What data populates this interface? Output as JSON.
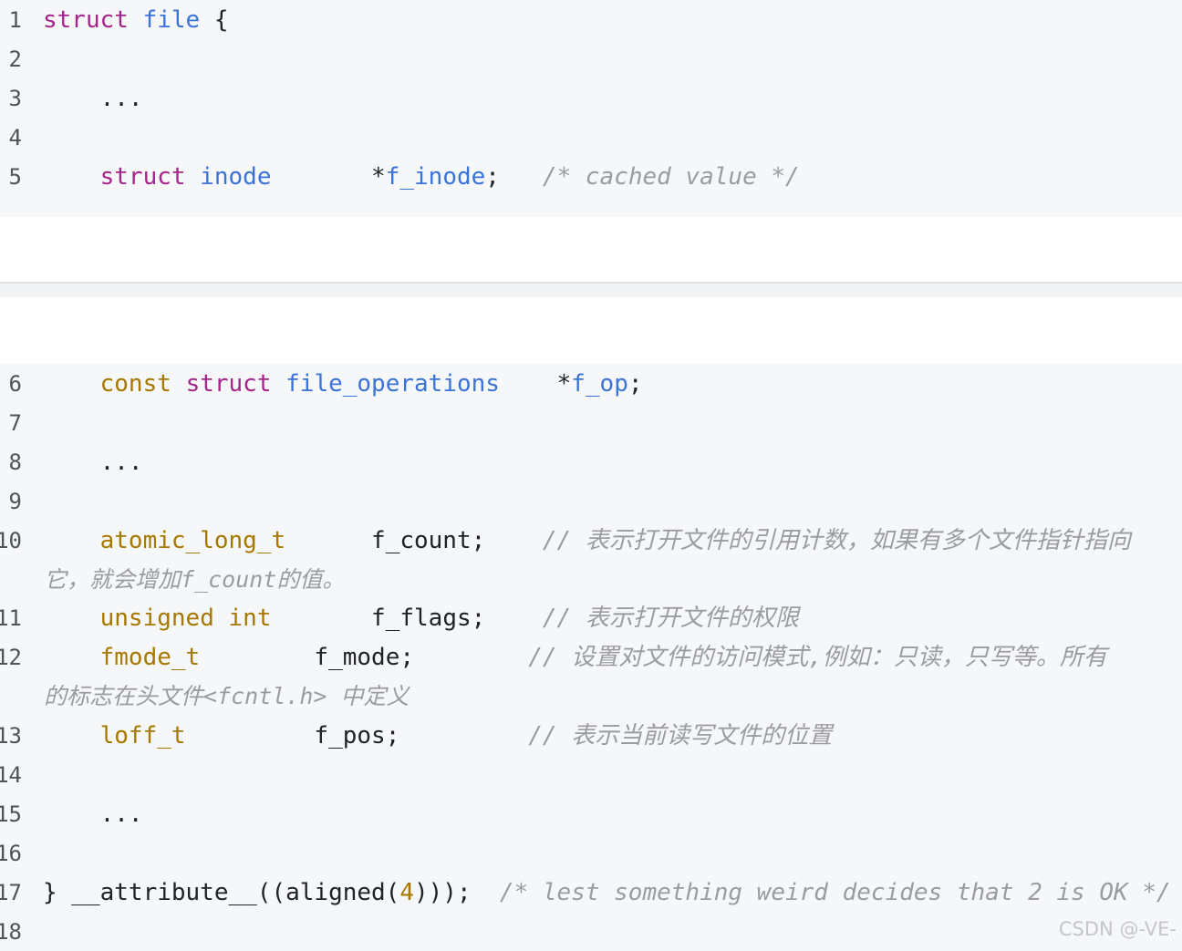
{
  "top_block": {
    "lines": [
      {
        "num": "1",
        "parts": [
          [
            "kw",
            "struct"
          ],
          [
            "",
            " "
          ],
          [
            "ty",
            "file"
          ],
          [
            "",
            " {"
          ]
        ]
      },
      {
        "num": "2",
        "parts": []
      },
      {
        "num": "3",
        "parts": [
          [
            "",
            "    ..."
          ]
        ]
      },
      {
        "num": "4",
        "parts": []
      },
      {
        "num": "5",
        "parts": [
          [
            "",
            "    "
          ],
          [
            "kw",
            "struct"
          ],
          [
            "",
            " "
          ],
          [
            "ty",
            "inode"
          ],
          [
            "",
            "       *"
          ],
          [
            "ty",
            "f_inode"
          ],
          [
            "",
            ";   "
          ],
          [
            "cm",
            "/* cached value */"
          ]
        ]
      }
    ]
  },
  "bottom_block": {
    "lines": [
      {
        "num": "6",
        "parts": [
          [
            "",
            "    "
          ],
          [
            "ty2",
            "const"
          ],
          [
            "",
            " "
          ],
          [
            "kw",
            "struct"
          ],
          [
            "",
            " "
          ],
          [
            "ty",
            "file_operations"
          ],
          [
            "",
            "    *"
          ],
          [
            "ty",
            "f_op"
          ],
          [
            "",
            ";"
          ]
        ]
      },
      {
        "num": "7",
        "parts": []
      },
      {
        "num": "8",
        "parts": [
          [
            "",
            "    ..."
          ]
        ]
      },
      {
        "num": "9",
        "parts": []
      },
      {
        "num": "10",
        "parts": [
          [
            "",
            "    "
          ],
          [
            "ty2",
            "atomic_long_t"
          ],
          [
            "",
            "      f_count;    "
          ],
          [
            "cm",
            "// 表示打开文件的引用计数，如果有多个文件指针指向"
          ]
        ],
        "cont": "它，就会增加f_count的值。"
      },
      {
        "num": "11",
        "parts": [
          [
            "",
            "    "
          ],
          [
            "ty2",
            "unsigned"
          ],
          [
            "",
            " "
          ],
          [
            "ty2",
            "int"
          ],
          [
            "",
            "       f_flags;    "
          ],
          [
            "cm",
            "// 表示打开文件的权限"
          ]
        ]
      },
      {
        "num": "12",
        "parts": [
          [
            "",
            "    "
          ],
          [
            "ty2",
            "fmode_t"
          ],
          [
            "",
            "        f_mode;        "
          ],
          [
            "cm",
            "// 设置对文件的访问模式,例如：只读，只写等。所有"
          ]
        ],
        "cont": "的标志在头文件<fcntl.h> 中定义"
      },
      {
        "num": "13",
        "parts": [
          [
            "",
            "    "
          ],
          [
            "ty2",
            "loff_t"
          ],
          [
            "",
            "         f_pos;         "
          ],
          [
            "cm",
            "// 表示当前读写文件的位置"
          ]
        ]
      },
      {
        "num": "14",
        "parts": []
      },
      {
        "num": "15",
        "parts": [
          [
            "",
            "    ..."
          ]
        ]
      },
      {
        "num": "16",
        "parts": []
      },
      {
        "num": "17",
        "parts": [
          [
            "",
            "} __attribute__((aligned("
          ],
          [
            "num",
            "4"
          ],
          [
            "",
            ")));  "
          ],
          [
            "cm",
            "/* lest something weird decides that 2 is OK */"
          ]
        ]
      },
      {
        "num": "18",
        "parts": []
      }
    ]
  },
  "watermark": "CSDN @-VE-"
}
